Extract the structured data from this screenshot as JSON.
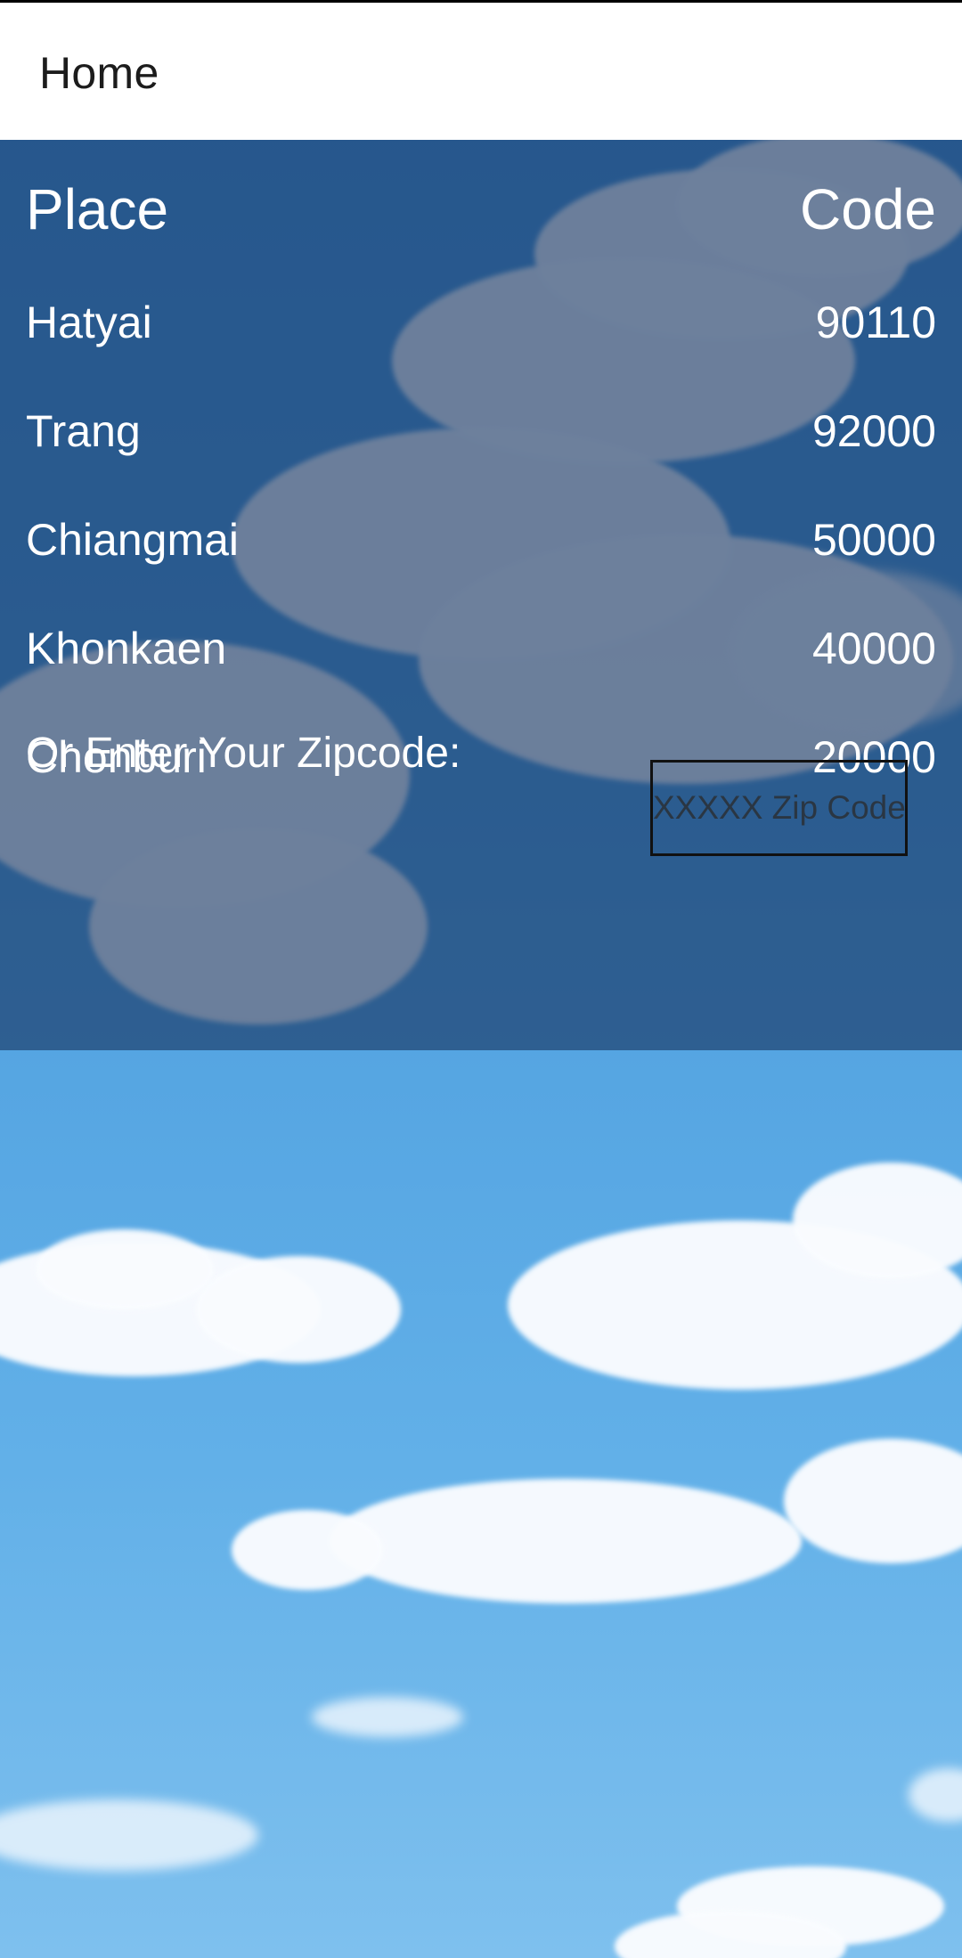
{
  "app_bar": {
    "title": "Home"
  },
  "table": {
    "header": {
      "place": "Place",
      "code": "Code"
    },
    "rows": [
      {
        "place": "Hatyai",
        "code": "90110"
      },
      {
        "place": "Trang",
        "code": "92000"
      },
      {
        "place": "Chiangmai",
        "code": "50000"
      },
      {
        "place": "Khonkaen",
        "code": "40000"
      },
      {
        "place": "Chonburi",
        "code": "20000"
      }
    ]
  },
  "zip": {
    "label": "Or Enter Your Zipcode:",
    "placeholder": "XXXXX Zip Code",
    "value": ""
  },
  "colors": {
    "app_bar_background": "#ffffff",
    "panel_overlay": "#173360",
    "sky": "#4d9ede",
    "text_on_panel": "#ffffff"
  }
}
